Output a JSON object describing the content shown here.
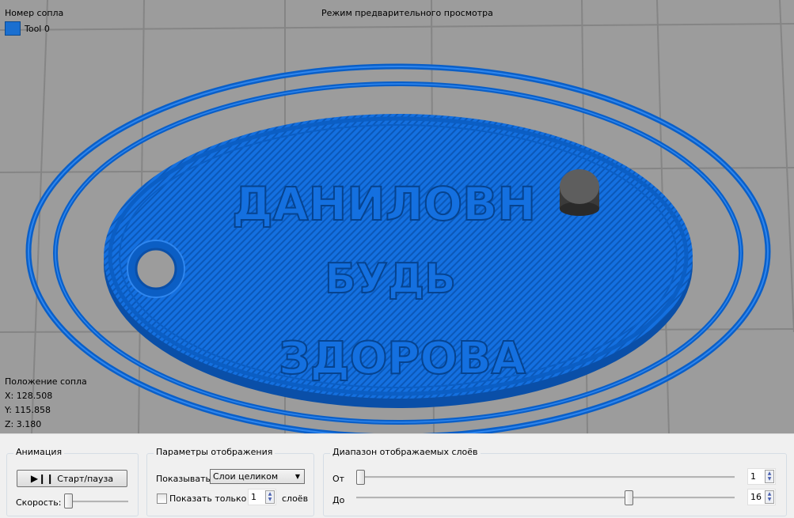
{
  "viewport": {
    "title": "Режим предварительного просмотра",
    "tool_legend_title": "Номер сопла",
    "tools": [
      {
        "label": "Tool 0",
        "color": "#1a6fd0"
      }
    ],
    "nozzle_position": {
      "title": "Положение сопла",
      "x": "X: 128.508",
      "y": "Y: 115.858",
      "z": "Z: 3.180"
    },
    "model_text": [
      "ДАНИЛОВН",
      "БУДЬ",
      "ЗДОРОВА"
    ],
    "model_color": "#0f6fe0",
    "background_color": "#9c9c9c"
  },
  "animation": {
    "title": "Анимация",
    "play_label": "Старт/пауза",
    "play_icon": "play-pause-icon",
    "speed_label": "Скорость:",
    "speed_value": 0
  },
  "display": {
    "title": "Параметры отображения",
    "show_label": "Показывать",
    "show_value": "Слои целиком",
    "only_label": "Показать только",
    "only_checked": false,
    "only_count": "1",
    "layers_label": "слоёв"
  },
  "range": {
    "title": "Диапазон отображаемых слоёв",
    "from_label": "От",
    "from_value": "1",
    "to_label": "До",
    "to_value": "16"
  }
}
